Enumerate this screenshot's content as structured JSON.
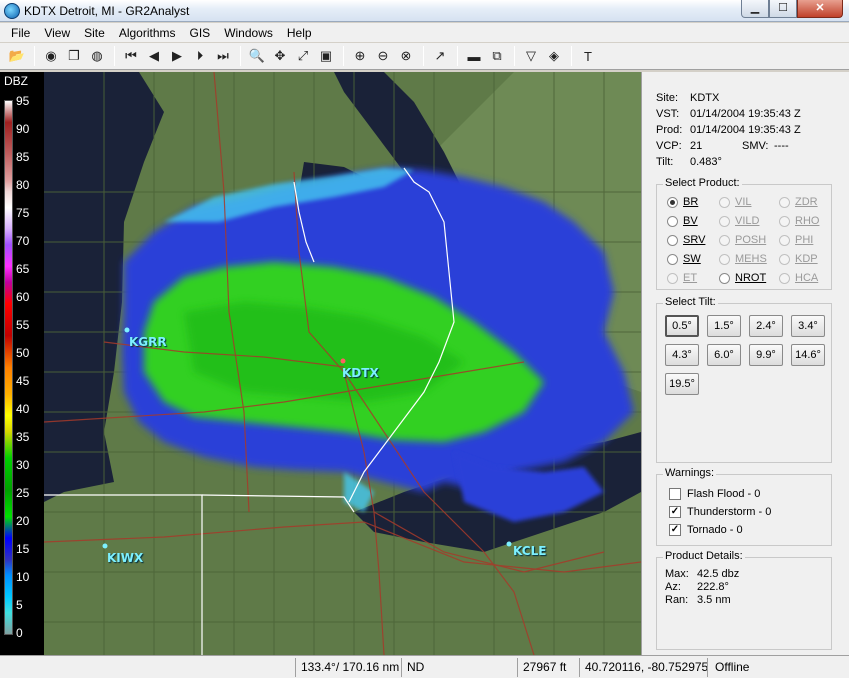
{
  "window": {
    "title": "KDTX Detroit, MI - GR2Analyst",
    "min_label": "▁",
    "max_label": "☐",
    "close_label": "✕"
  },
  "menu": [
    "File",
    "View",
    "Site",
    "Algorithms",
    "GIS",
    "Windows",
    "Help"
  ],
  "toolbar": {
    "buttons": [
      {
        "name": "open-icon",
        "glyph": "📂"
      },
      {
        "name": "globe-icon",
        "glyph": "◉"
      },
      {
        "name": "copy-icon",
        "glyph": "❐"
      },
      {
        "name": "refresh-icon",
        "glyph": "◍"
      },
      {
        "name": "first-frame-icon",
        "glyph": "⏮"
      },
      {
        "name": "step-back-icon",
        "glyph": "◀"
      },
      {
        "name": "play-icon",
        "glyph": "▶"
      },
      {
        "name": "step-forward-icon",
        "glyph": "⏵"
      },
      {
        "name": "last-frame-icon",
        "glyph": "⏭"
      },
      {
        "name": "zoom-icon",
        "glyph": "🔍"
      },
      {
        "name": "pan-icon",
        "glyph": "✥"
      },
      {
        "name": "measure-icon",
        "glyph": "⤢"
      },
      {
        "name": "layers-icon",
        "glyph": "▣"
      },
      {
        "name": "zoom-in-icon",
        "glyph": "⊕"
      },
      {
        "name": "zoom-out-icon",
        "glyph": "⊖"
      },
      {
        "name": "zoom-reset-icon",
        "glyph": "⊗"
      },
      {
        "name": "vector-icon",
        "glyph": "↗"
      },
      {
        "name": "cross-section-icon",
        "glyph": "▬"
      },
      {
        "name": "split-icon",
        "glyph": "⧉"
      },
      {
        "name": "filter-icon",
        "glyph": "▽"
      },
      {
        "name": "diamond-icon",
        "glyph": "◈"
      },
      {
        "name": "text-icon",
        "glyph": "T"
      }
    ]
  },
  "scale": {
    "title": "DBZ",
    "labels": [
      "95",
      "90",
      "85",
      "80",
      "75",
      "70",
      "65",
      "60",
      "55",
      "50",
      "45",
      "40",
      "35",
      "30",
      "25",
      "20",
      "15",
      "10",
      "5",
      "0"
    ]
  },
  "map": {
    "sites": [
      {
        "name": "KGRR"
      },
      {
        "name": "KDTX"
      },
      {
        "name": "KIWX"
      },
      {
        "name": "KCLE"
      }
    ],
    "colors": {
      "radar_blue": "#2a40d8",
      "radar_green": "#30d020",
      "land": "#5f7a48",
      "lake": "#17203a"
    }
  },
  "info": {
    "site_key": "Site:",
    "site_val": "KDTX",
    "vst_key": "VST:",
    "vst_val": "01/14/2004  19:35:43 Z",
    "prod_key": "Prod:",
    "prod_val": "01/14/2004  19:35:43 Z",
    "vcp_key": "VCP:",
    "vcp_val": "21",
    "smv_key": "SMV:",
    "smv_val": "----",
    "tilt_key": "Tilt:",
    "tilt_val": "0.483°"
  },
  "product": {
    "title": "Select Product:",
    "options": [
      {
        "label": "BR",
        "selected": true,
        "enabled": true
      },
      {
        "label": "VIL",
        "selected": false,
        "enabled": false
      },
      {
        "label": "ZDR",
        "selected": false,
        "enabled": false
      },
      {
        "label": "BV",
        "selected": false,
        "enabled": true
      },
      {
        "label": "VILD",
        "selected": false,
        "enabled": false
      },
      {
        "label": "RHO",
        "selected": false,
        "enabled": false
      },
      {
        "label": "SRV",
        "selected": false,
        "enabled": true
      },
      {
        "label": "POSH",
        "selected": false,
        "enabled": false
      },
      {
        "label": "PHI",
        "selected": false,
        "enabled": false
      },
      {
        "label": "SW",
        "selected": false,
        "enabled": true
      },
      {
        "label": "MEHS",
        "selected": false,
        "enabled": false
      },
      {
        "label": "KDP",
        "selected": false,
        "enabled": false
      },
      {
        "label": "ET",
        "selected": false,
        "enabled": false
      },
      {
        "label": "NROT",
        "selected": false,
        "enabled": true
      },
      {
        "label": "HCA",
        "selected": false,
        "enabled": false
      }
    ]
  },
  "tilt": {
    "title": "Select Tilt:",
    "options": [
      "0.5°",
      "1.5°",
      "2.4°",
      "3.4°",
      "4.3°",
      "6.0°",
      "9.9°",
      "14.6°",
      "19.5°"
    ],
    "active_index": 0
  },
  "warnings": {
    "title": "Warnings:",
    "items": [
      {
        "label": "Flash Flood - 0",
        "checked": false
      },
      {
        "label": "Thunderstorm - 0",
        "checked": true
      },
      {
        "label": "Tornado - 0",
        "checked": true
      }
    ]
  },
  "details": {
    "title": "Product Details:",
    "max_key": "Max:",
    "max_val": "42.5 dbz",
    "az_key": "Az:",
    "az_val": "222.8°",
    "ran_key": "Ran:",
    "ran_val": "3.5 nm"
  },
  "status": {
    "bearing": "133.4°/ 170.16 nm",
    "value": "ND",
    "height": "27967 ft",
    "coords": "40.720116, -80.752975",
    "connection": "Offline"
  }
}
